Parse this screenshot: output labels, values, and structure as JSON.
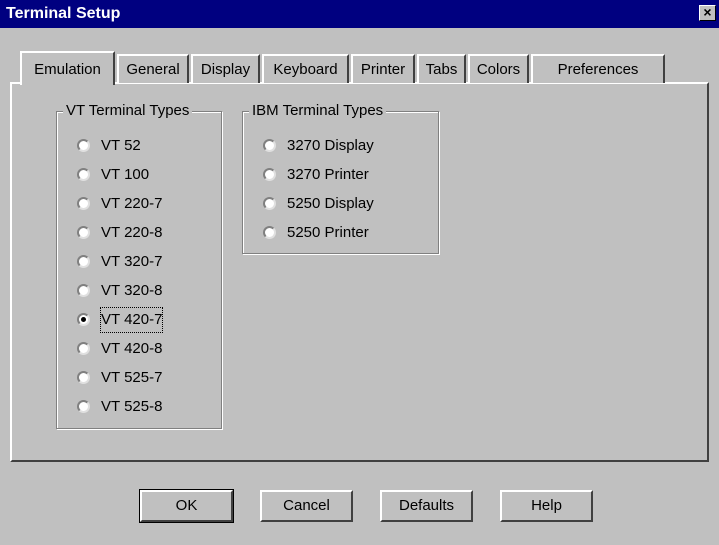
{
  "window": {
    "title": "Terminal Setup",
    "close_glyph": "×"
  },
  "tabs": [
    "Emulation",
    "General",
    "Display",
    "Keyboard",
    "Printer",
    "Tabs",
    "Colors",
    "Preferences"
  ],
  "vt_group": {
    "label": "VT Terminal Types",
    "options": [
      "VT 52",
      "VT 100",
      "VT 220-7",
      "VT 220-8",
      "VT 320-7",
      "VT 320-8",
      "VT 420-7",
      "VT 420-8",
      "VT 525-7",
      "VT 525-8"
    ],
    "selected": "VT 420-7"
  },
  "ibm_group": {
    "label": "IBM Terminal Types",
    "options": [
      "3270 Display",
      "3270 Printer",
      "5250 Display",
      "5250 Printer"
    ]
  },
  "buttons": {
    "ok": "OK",
    "cancel": "Cancel",
    "defaults": "Defaults",
    "help": "Help"
  }
}
